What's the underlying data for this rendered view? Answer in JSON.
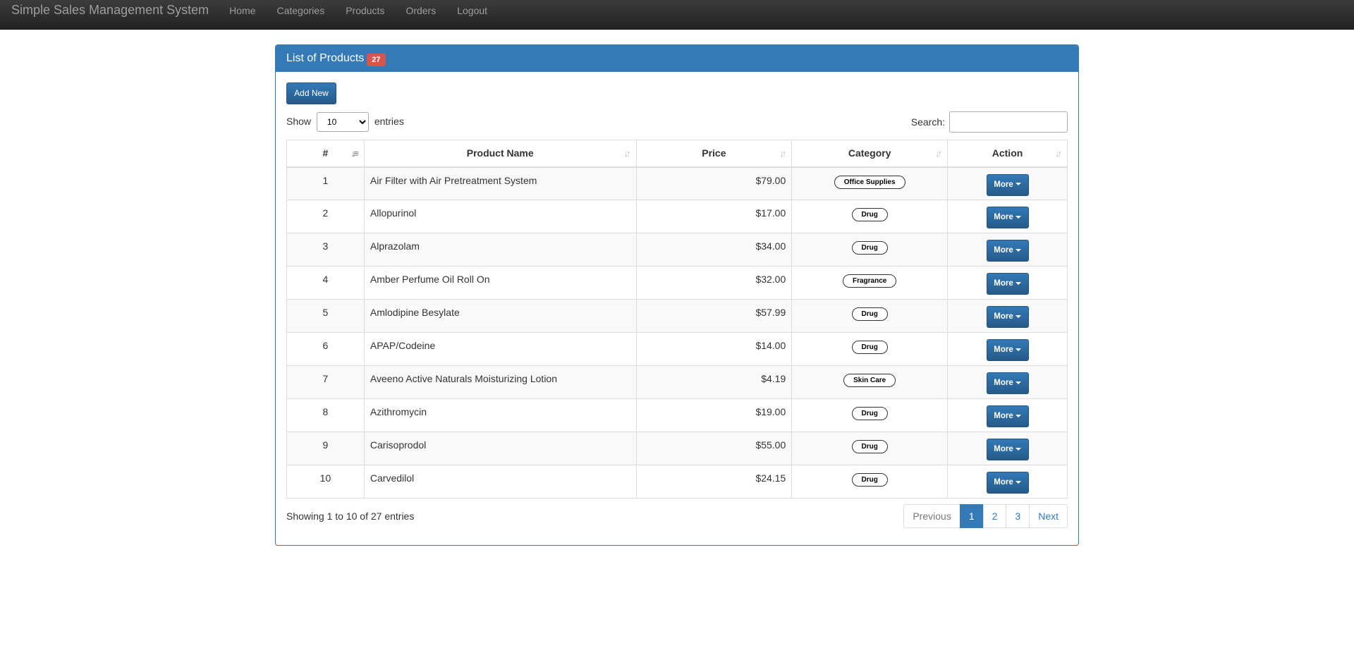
{
  "navbar": {
    "brand": "Simple Sales Management System",
    "links": [
      "Home",
      "Categories",
      "Products",
      "Orders",
      "Logout"
    ]
  },
  "panel": {
    "title": "List of Products",
    "count_badge": "27",
    "add_button": "Add New"
  },
  "length_control": {
    "show_label": "Show",
    "selected": "10",
    "entries_label": "entries"
  },
  "search": {
    "label": "Search:",
    "value": ""
  },
  "table": {
    "headers": [
      "#",
      "Product Name",
      "Price",
      "Category",
      "Action"
    ],
    "action_label": "More",
    "rows": [
      {
        "num": "1",
        "name": "Air Filter with Air Pretreatment System",
        "price": "$79.00",
        "category": "Office Supplies"
      },
      {
        "num": "2",
        "name": "Allopurinol",
        "price": "$17.00",
        "category": "Drug"
      },
      {
        "num": "3",
        "name": "Alprazolam",
        "price": "$34.00",
        "category": "Drug"
      },
      {
        "num": "4",
        "name": "Amber Perfume Oil Roll On",
        "price": "$32.00",
        "category": "Fragrance"
      },
      {
        "num": "5",
        "name": "Amlodipine Besylate",
        "price": "$57.99",
        "category": "Drug"
      },
      {
        "num": "6",
        "name": "APAP/Codeine",
        "price": "$14.00",
        "category": "Drug"
      },
      {
        "num": "7",
        "name": "Aveeno Active Naturals Moisturizing Lotion",
        "price": "$4.19",
        "category": "Skin Care"
      },
      {
        "num": "8",
        "name": "Azithromycin",
        "price": "$19.00",
        "category": "Drug"
      },
      {
        "num": "9",
        "name": "Carisoprodol",
        "price": "$55.00",
        "category": "Drug"
      },
      {
        "num": "10",
        "name": "Carvedilol",
        "price": "$24.15",
        "category": "Drug"
      }
    ]
  },
  "footer": {
    "info": "Showing 1 to 10 of 27 entries",
    "pagination": {
      "previous": "Previous",
      "pages": [
        "1",
        "2",
        "3"
      ],
      "next": "Next",
      "current": "1"
    }
  }
}
